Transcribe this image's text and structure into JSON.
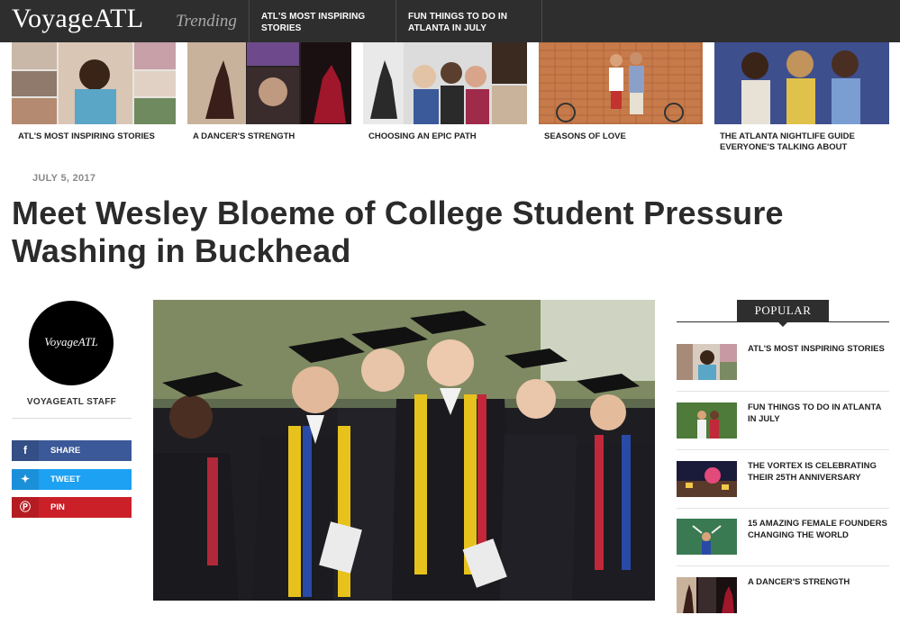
{
  "site": {
    "logo": "VoyageATL",
    "trending_label": "Trending",
    "nav_links": [
      "ATL'S MOST INSPIRING STORIES",
      "FUN THINGS TO DO IN ATLANTA IN JULY"
    ]
  },
  "trending_tiles": [
    {
      "caption": "ATL'S MOST INSPIRING STORIES"
    },
    {
      "caption": "A DANCER'S STRENGTH"
    },
    {
      "caption": "CHOOSING AN EPIC PATH"
    },
    {
      "caption": "SEASONS OF LOVE"
    },
    {
      "caption": "THE ATLANTA NIGHTLIFE GUIDE EVERYONE'S TALKING ABOUT"
    }
  ],
  "article": {
    "date": "JULY 5, 2017",
    "title": "Meet Wesley Bloeme of College Student Pressure Washing in Buckhead"
  },
  "author": {
    "avatar_text": "VoyageATL",
    "name": "VOYAGEATL STAFF"
  },
  "share": {
    "facebook": "SHARE",
    "twitter": "TWEET",
    "pinterest": "PIN"
  },
  "popular": {
    "heading": "POPULAR",
    "items": [
      "ATL'S MOST INSPIRING STORIES",
      "FUN THINGS TO DO IN ATLANTA IN JULY",
      "THE VORTEX IS CELEBRATING THEIR 25TH ANNIVERSARY",
      "15 AMAZING FEMALE FOUNDERS CHANGING THE WORLD",
      "A DANCER'S STRENGTH"
    ]
  },
  "colors": {
    "topbar": "#2e2e2e",
    "facebook": "#3b5998",
    "twitter": "#1da1f2",
    "pinterest": "#cb2027"
  }
}
